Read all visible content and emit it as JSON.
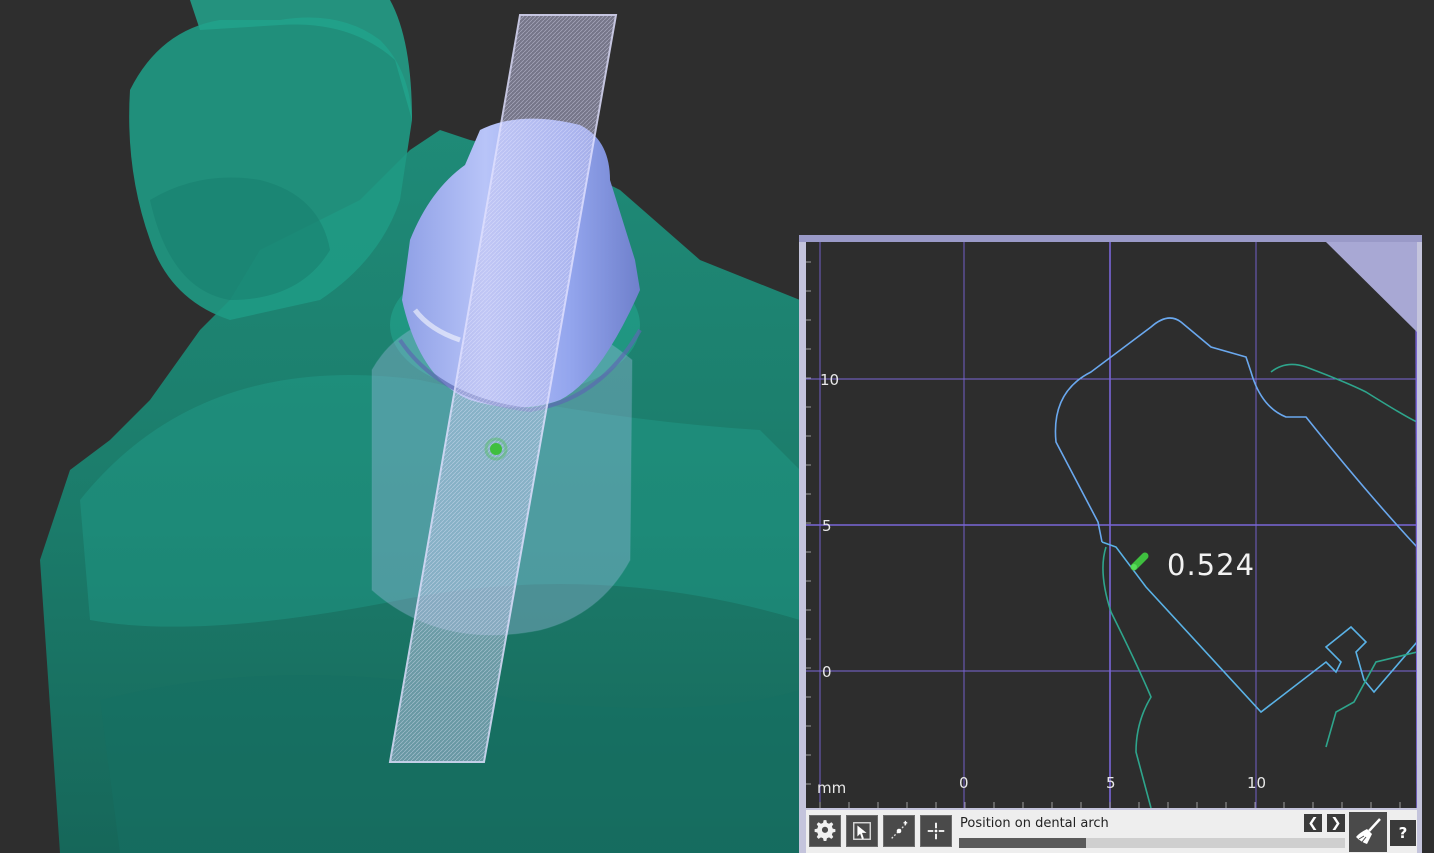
{
  "viewport": {
    "model_color": "#1f8a76",
    "implant_color": "#9aa8e8",
    "cut_plane_color": "#c8c8f0",
    "background_color": "#2e2e2e"
  },
  "section_view": {
    "unit_label": "mm",
    "measurement": {
      "value": "0.524",
      "marker_color": "#3fbf3f"
    },
    "x_ticks": [
      "0",
      "5",
      "10"
    ],
    "y_ticks": [
      "10",
      "5",
      "0"
    ],
    "grid_color": "#7a66d8",
    "outer_contour_color": "#6aa8ee",
    "inner_contour_color": "#2ea58c"
  },
  "toolbar": {
    "settings_icon": "gear-icon",
    "view_icon": "view-mode-icon",
    "measure_icon": "measure-distance-icon",
    "pan_icon": "crosshair-icon",
    "arch_label": "Position on dental arch",
    "arch_prev_icon": "chevron-left-icon",
    "arch_next_icon": "chevron-right-icon",
    "arch_position": 0.33,
    "clear_icon": "broom-icon",
    "help_label": "?"
  }
}
